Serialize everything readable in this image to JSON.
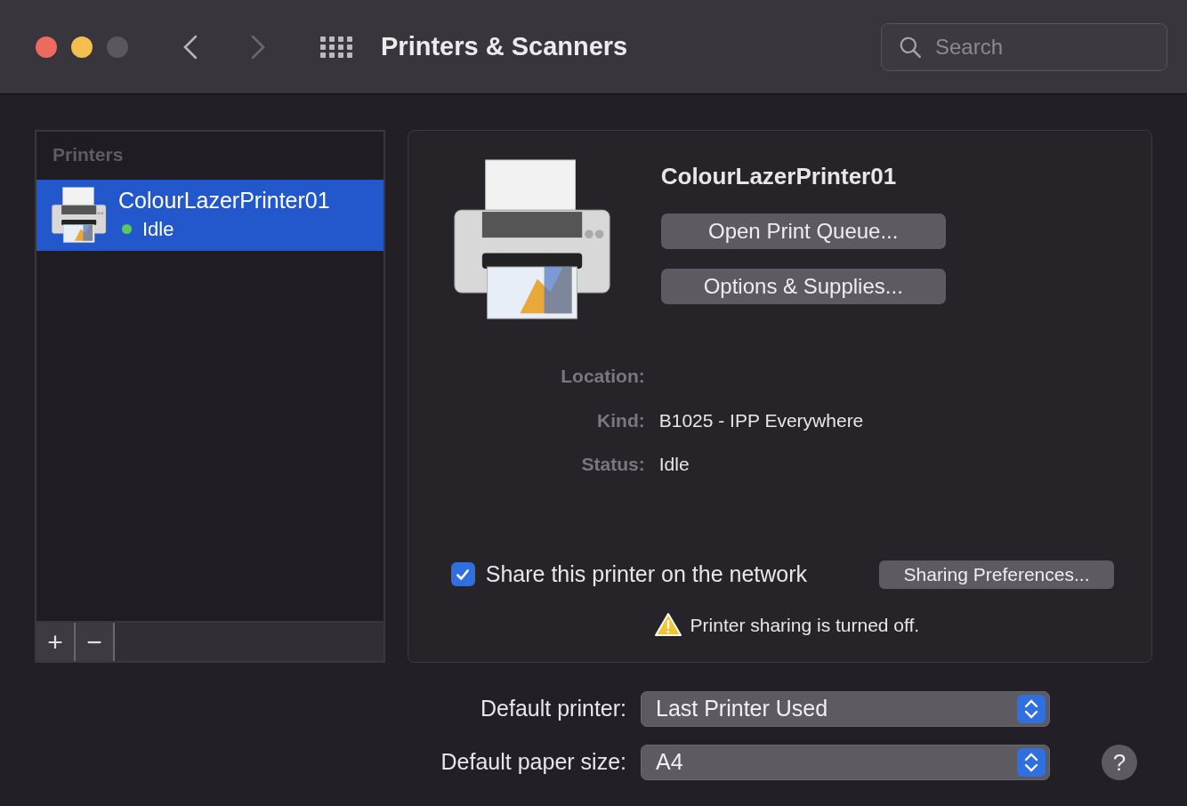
{
  "window": {
    "title": "Printers & Scanners"
  },
  "navigation": [
    {
      "kind": "back",
      "disabled": false
    },
    {
      "kind": "forward",
      "disabled": true
    }
  ],
  "search": {
    "placeholder": "Search"
  },
  "printers_list": {
    "heading": "Printers",
    "items": [
      {
        "name": "ColourLazerPrinter01",
        "status": "Idle",
        "color": "#5ac85a",
        "selected": true
      }
    ],
    "buttons": [
      "+",
      "−"
    ]
  },
  "detail": {
    "name": "ColourLazerPrinter01",
    "buttons": [
      "Open Print Queue...",
      "Options & Supplies..."
    ],
    "info": [
      {
        "label": "Location:"
      },
      {
        "label": "Kind:",
        "value": "B1025 - IPP Everywhere"
      },
      {
        "label": "Status:",
        "value": "Idle"
      }
    ],
    "share": {
      "label": "Share this printer on the network",
      "checked": true
    },
    "sharing_button": "Sharing Preferences...",
    "warning": "Printer sharing is turned off."
  },
  "defaults": [
    {
      "label": "Default printer:",
      "value": "Last Printer Used"
    },
    {
      "label": "Default paper size:",
      "value": "A4"
    }
  ],
  "help": "?"
}
